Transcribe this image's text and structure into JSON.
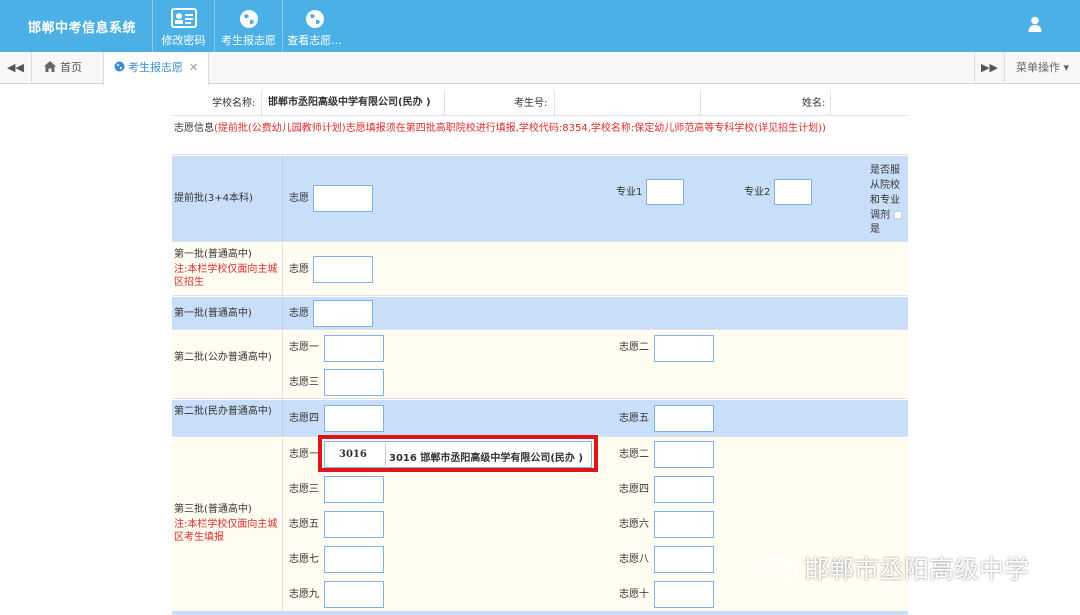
{
  "app": {
    "title": "邯郸中考信息系统"
  },
  "toolbar": {
    "change_password": "修改密码",
    "apply": "考生报志愿",
    "view": "查看志愿..."
  },
  "tabs": {
    "home": "首页",
    "active": "考生报志愿",
    "close": "✕",
    "menu": "菜单操作 ▾"
  },
  "header": {
    "school_label": "学校名称:",
    "school_value": "邯郸市丞阳高级中学有限公司(民办 )",
    "exam_no_label": "考生号:",
    "name_label": "姓名:"
  },
  "notice": {
    "prefix": "志愿信息",
    "text": "(提前批(公费幼儿园教师计划)志愿填报须在第四批高职院校进行填报,学校代码:8354,学校名称:保定幼儿师范高等专科学校(详见招生计划))"
  },
  "early_batch": {
    "label": "提前批(3+4本科)",
    "wish": "志愿",
    "major1": "专业1",
    "major2": "专业2",
    "obey": "是否服从院校和专业调剂",
    "obey_value": "是"
  },
  "batch1_main": {
    "label": "第一批(普通高中)",
    "note": "注:本栏学校仅面向主城区招生",
    "wish": "志愿"
  },
  "batch1": {
    "label": "第一批(普通高中)",
    "wish": "志愿"
  },
  "batch2_public": {
    "label": "第二批(公办普通高中)",
    "w1": "志愿一",
    "w2": "志愿二",
    "w3": "志愿三"
  },
  "batch2_private": {
    "label": "第二批(民办普通高中)",
    "w4": "志愿四",
    "w5": "志愿五"
  },
  "batch3": {
    "label": "第三批(普通高中)",
    "note": "注:本栏学校仅面向主城区考生填报",
    "w1": "志愿一",
    "w1_code": "3016",
    "w1_display": "3016 邯郸市丞阳高级中学有限公司(民办 )",
    "w2": "志愿二",
    "w3": "志愿三",
    "w4": "志愿四",
    "w5": "志愿五",
    "w6": "志愿六",
    "w7": "志愿七",
    "w8": "志愿八",
    "w9": "志愿九",
    "w10": "志愿十"
  },
  "watermark": {
    "text": "邯郸市丞阳高级中学"
  }
}
